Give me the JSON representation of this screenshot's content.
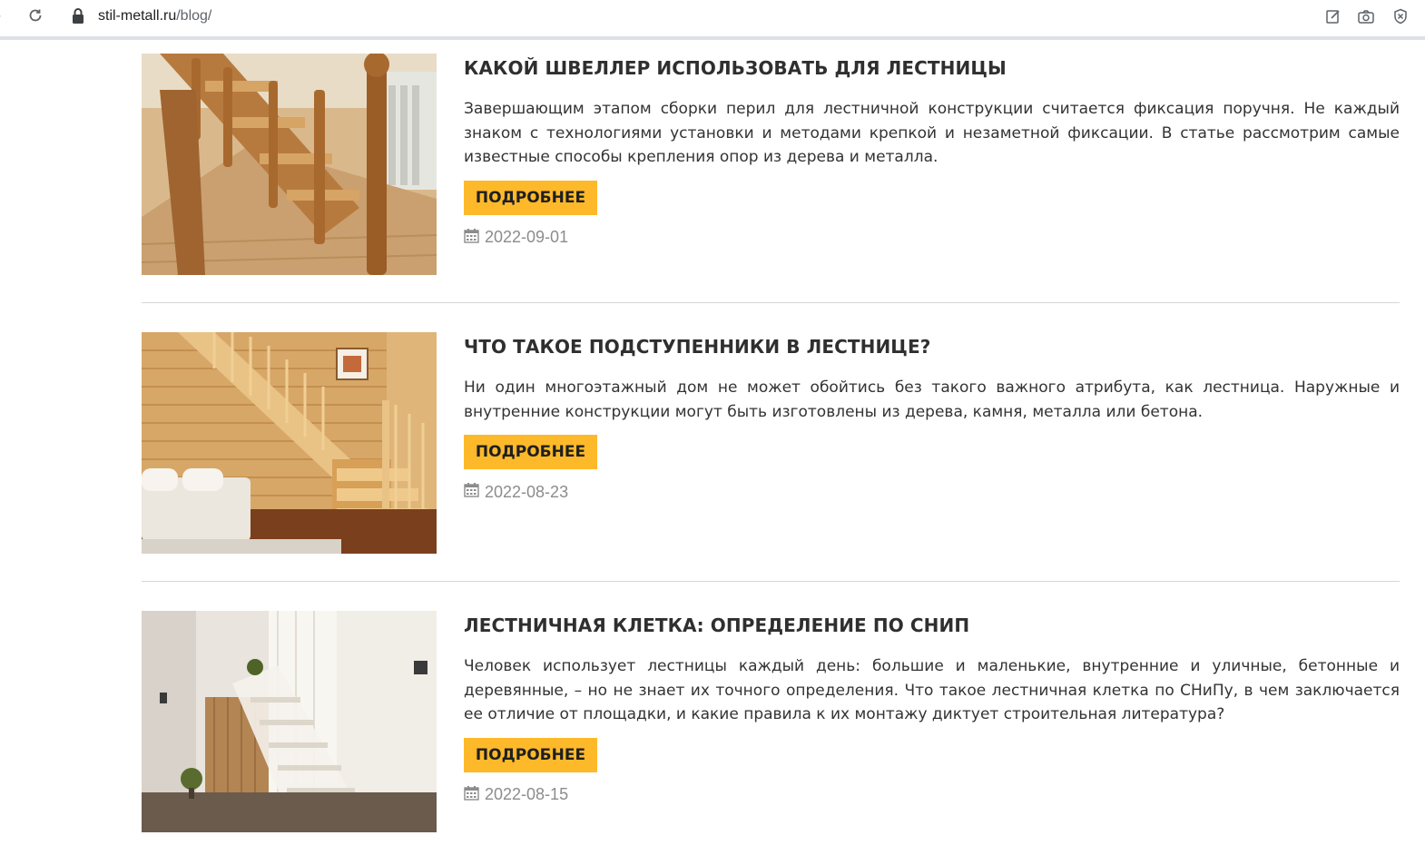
{
  "browser": {
    "url_host": "stil-metall.ru",
    "url_path": "/blog/"
  },
  "posts": [
    {
      "title": "КАКОЙ ШВЕЛЛЕР ИСПОЛЬЗОВАТЬ ДЛЯ ЛЕСТНИЦЫ",
      "excerpt": "Завершающим этапом сборки перил для лестничной конструкции считается фиксация поручня. Не каждый знаком с технологиями установки и методами крепкой и незаметной фиксации. В статье рассмотрим самые известные способы крепления опор из дерева и металла.",
      "button": "ПОДРОБНЕЕ",
      "date": "2022-09-01"
    },
    {
      "title": "ЧТО ТАКОЕ ПОДСТУПЕННИКИ В ЛЕСТНИЦЕ?",
      "excerpt": "Ни один многоэтажный дом не может обойтись без такого важного атрибута, как лестница. Наружные и внутренние конструкции могут быть изготовлены из дерева, камня, металла или бетона.",
      "button": "ПОДРОБНЕЕ",
      "date": "2022-08-23"
    },
    {
      "title": "ЛЕСТНИЧНАЯ КЛЕТКА: ОПРЕДЕЛЕНИЕ ПО СНИП",
      "excerpt": "Человек использует лестницы каждый день: большие и маленькие, внутренние и уличные, бетонные и деревянные, – но не знает их точного определения. Что такое лестничная клетка по СНиПу, в чем заключается ее отличие от площадки, и какие правила к их монтажу диктует строительная литература?",
      "button": "ПОДРОБНЕЕ",
      "date": "2022-08-15"
    }
  ],
  "colors": {
    "accent": "#fdb92a",
    "divider": "#d6d6d6",
    "date": "#8c8c8c"
  },
  "icons": [
    "reload-icon",
    "lock-icon",
    "edit-icon",
    "camera-icon",
    "shield-close-icon",
    "calendar-icon"
  ]
}
